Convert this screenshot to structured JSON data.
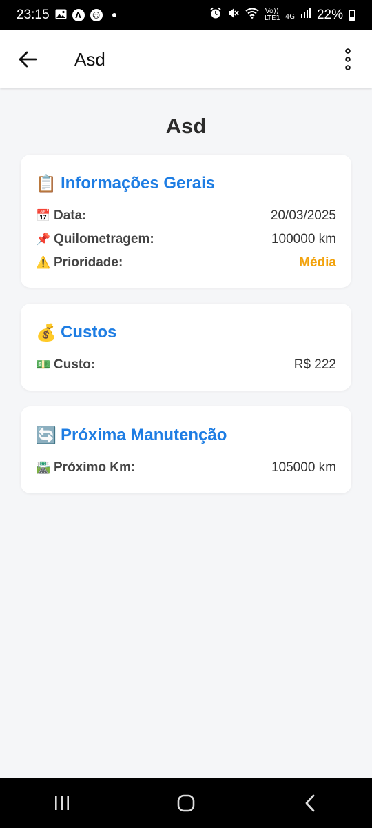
{
  "status_bar": {
    "time": "23:15",
    "battery": "22%",
    "network": "4G",
    "volte": "Vo)) LTE1"
  },
  "app_bar": {
    "title": "Asd"
  },
  "page": {
    "title": "Asd"
  },
  "cards": {
    "general": {
      "emoji": "📋",
      "title": "Informações Gerais",
      "rows": [
        {
          "emoji": "📅",
          "label": "Data:",
          "value": "20/03/2025"
        },
        {
          "emoji": "📌",
          "label": "Quilometragem:",
          "value": "100000 km"
        },
        {
          "emoji": "⚠️",
          "label": "Prioridade:",
          "value": "Média"
        }
      ]
    },
    "costs": {
      "emoji": "💰",
      "title": "Custos",
      "rows": [
        {
          "emoji": "💵",
          "label": "Custo:",
          "value": "R$ 222"
        }
      ]
    },
    "next": {
      "emoji": "🔄",
      "title": "Próxima Manutenção",
      "rows": [
        {
          "emoji": "🛣️",
          "label": "Próximo Km:",
          "value": "105000 km"
        }
      ]
    }
  },
  "colors": {
    "accent": "#1e7de3",
    "priority_medium": "#f2a20c",
    "background": "#f5f6f8"
  }
}
